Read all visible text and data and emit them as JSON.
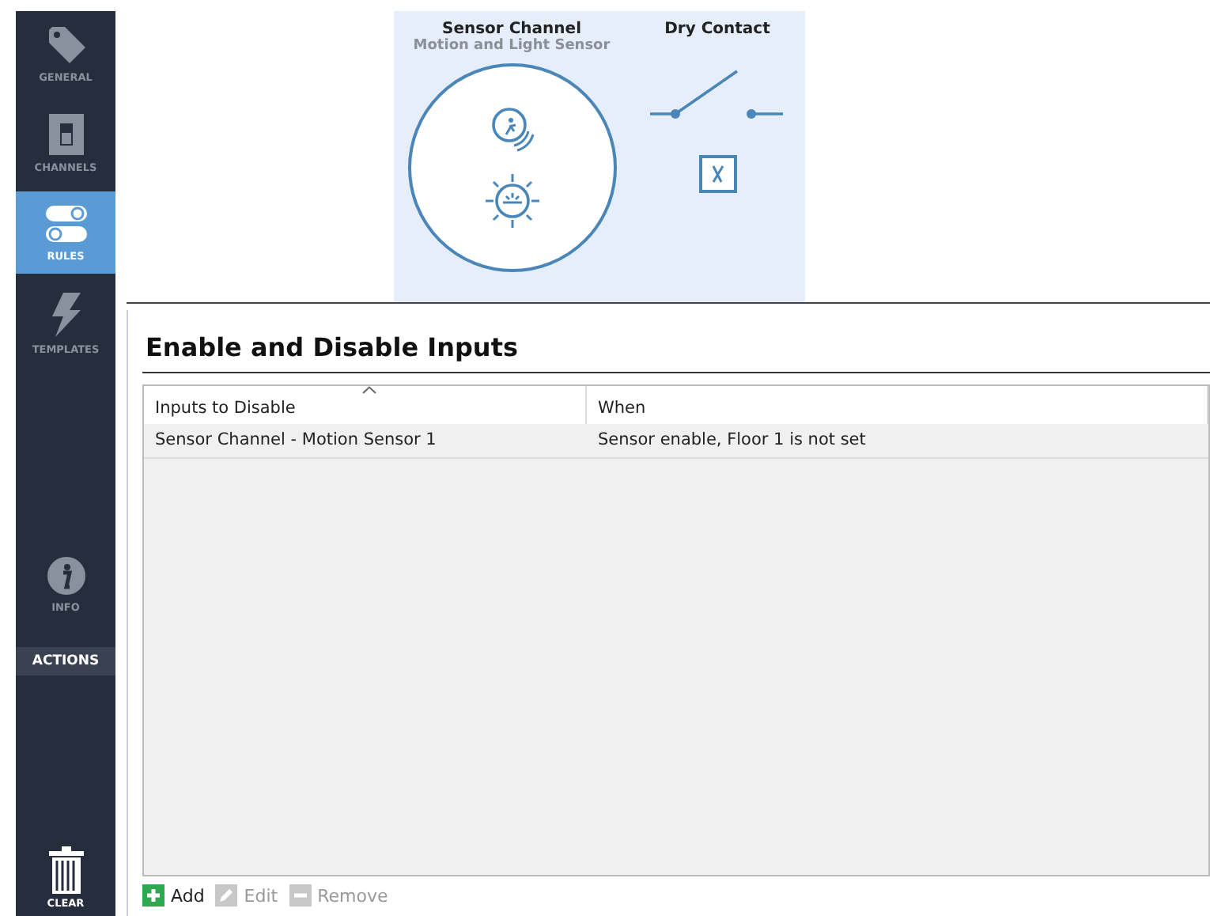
{
  "sidebar": {
    "items": [
      {
        "label": "GENERAL",
        "kind": "tag",
        "selected": false
      },
      {
        "label": "CHANNELS",
        "kind": "switch",
        "selected": false
      },
      {
        "label": "RULES",
        "kind": "toggles",
        "selected": true
      },
      {
        "label": "TEMPLATES",
        "kind": "bolt",
        "selected": false
      }
    ],
    "info": {
      "label": "INFO"
    },
    "actions_header": "ACTIONS",
    "clear": {
      "label": "CLEAR"
    }
  },
  "diagram": {
    "sensor": {
      "title": "Sensor Channel",
      "subtitle": "Motion and Light Sensor"
    },
    "contact": {
      "title": "Dry Contact"
    }
  },
  "panel": {
    "title": "Enable and Disable Inputs",
    "table": {
      "columns": [
        "Inputs to Disable",
        "When"
      ],
      "rows": [
        {
          "cells": [
            "Sensor Channel - Motion Sensor 1",
            "Sensor enable, Floor 1 is not set"
          ]
        }
      ]
    },
    "toolbar": [
      {
        "label": "Add",
        "kind": "add",
        "disabled": false
      },
      {
        "label": "Edit",
        "kind": "edit",
        "disabled": true
      },
      {
        "label": "Remove",
        "kind": "remove",
        "disabled": true
      }
    ]
  }
}
